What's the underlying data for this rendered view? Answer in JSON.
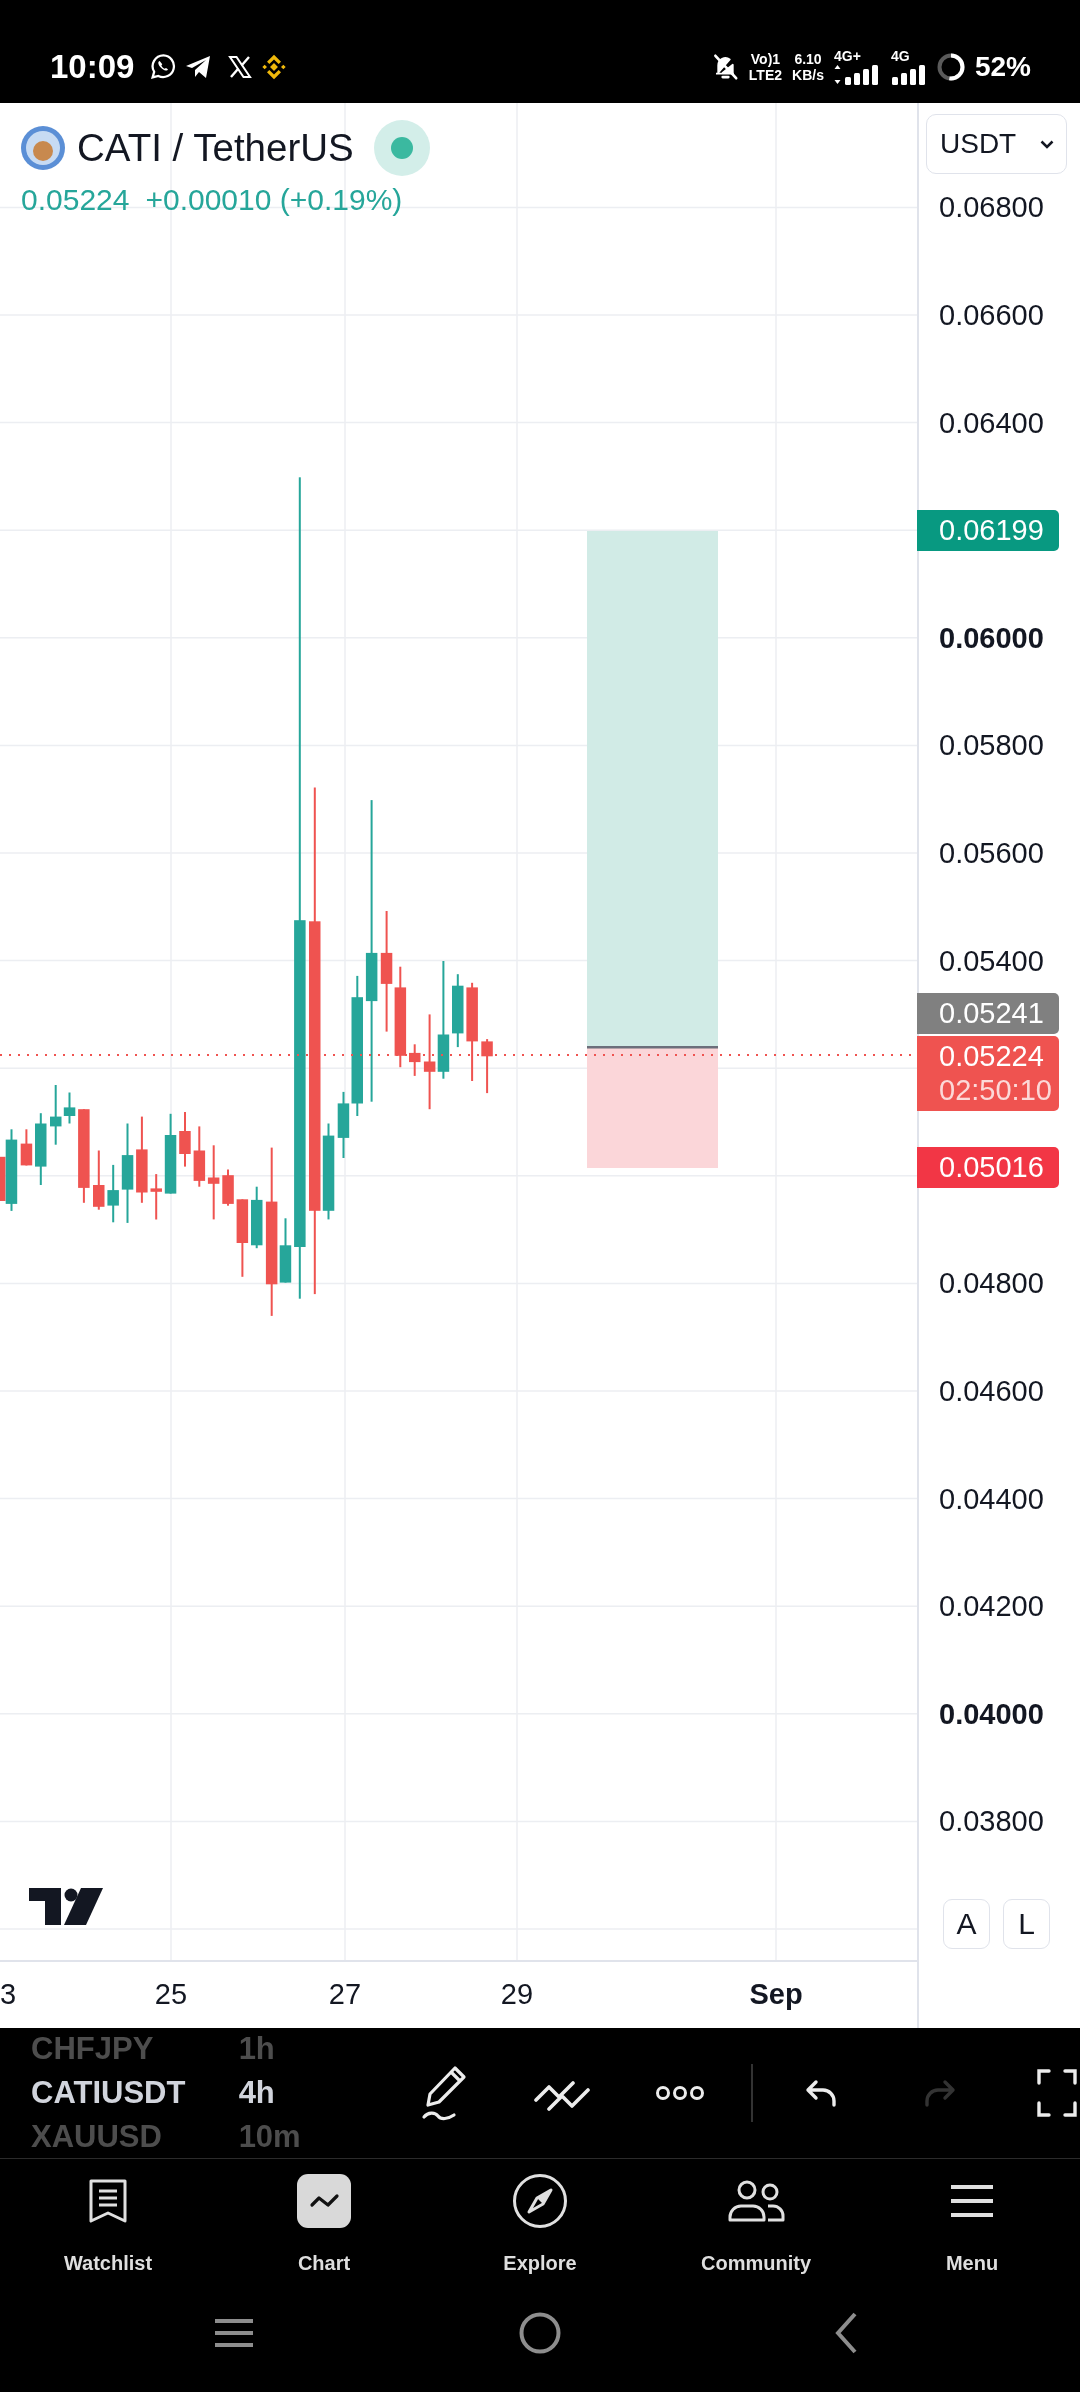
{
  "status_bar": {
    "time": "10:09",
    "volte": "Vo)1",
    "sim_network": "LTE2",
    "speed": "6.10",
    "speed_unit": "KB/s",
    "sim1_network": "4G+",
    "sim2_network": "4G",
    "battery": "52%"
  },
  "header": {
    "symbol": "CATI / TetherUS",
    "market_open": true,
    "price": "0.05224",
    "change": "+0.00010 (+0.19%)",
    "change_positive": true
  },
  "currency_select": {
    "value": "USDT"
  },
  "price_axis": {
    "ticks": [
      {
        "label": "0.06800",
        "major": false
      },
      {
        "label": "0.06600",
        "major": false
      },
      {
        "label": "0.06400",
        "major": false
      },
      {
        "label": "0.06000",
        "major": true
      },
      {
        "label": "0.05800",
        "major": false
      },
      {
        "label": "0.05600",
        "major": false
      },
      {
        "label": "0.05400",
        "major": false
      },
      {
        "label": "0.04800",
        "major": false
      },
      {
        "label": "0.04600",
        "major": false
      },
      {
        "label": "0.04400",
        "major": false
      },
      {
        "label": "0.04200",
        "major": false
      },
      {
        "label": "0.04000",
        "major": true
      },
      {
        "label": "0.03800",
        "major": false
      }
    ],
    "badges": [
      {
        "label": "0.06199",
        "color": "#089981"
      },
      {
        "label": "0.05241",
        "color": "#808080"
      },
      {
        "label": "0.05224",
        "sublabel": "02:50:10",
        "color": "#ef5350"
      },
      {
        "label": "0.05016",
        "color": "#f23645"
      }
    ]
  },
  "time_axis": {
    "labels": [
      {
        "label": "3",
        "major": false
      },
      {
        "label": "25",
        "major": false
      },
      {
        "label": "27",
        "major": false
      },
      {
        "label": "29",
        "major": false
      },
      {
        "label": "Sep",
        "major": true
      }
    ]
  },
  "scale_buttons": [
    {
      "label": "A",
      "selected": false
    },
    {
      "label": "L",
      "selected": false
    }
  ],
  "symbol_picker": [
    {
      "symbol": "CHFJPY",
      "interval": "1h",
      "selected": false
    },
    {
      "symbol": "CATIUSDT",
      "interval": "4h",
      "selected": true
    },
    {
      "symbol": "XAUUSD",
      "interval": "10m",
      "selected": false
    }
  ],
  "tools": [
    {
      "kind": "draw",
      "disabled": false
    },
    {
      "kind": "trend",
      "disabled": false
    },
    {
      "kind": "more",
      "disabled": false
    },
    {
      "kind": "undo",
      "disabled": false
    },
    {
      "kind": "redo",
      "disabled": true
    },
    {
      "kind": "fullscreen",
      "disabled": false
    }
  ],
  "bottom_nav": [
    {
      "label": "Watchlist",
      "kind": "watchlist",
      "selected": false
    },
    {
      "label": "Chart",
      "kind": "chart",
      "selected": true
    },
    {
      "label": "Explore",
      "kind": "explore",
      "selected": false
    },
    {
      "label": "Community",
      "kind": "community",
      "selected": false
    },
    {
      "label": "Menu",
      "kind": "menu",
      "selected": false
    }
  ]
}
